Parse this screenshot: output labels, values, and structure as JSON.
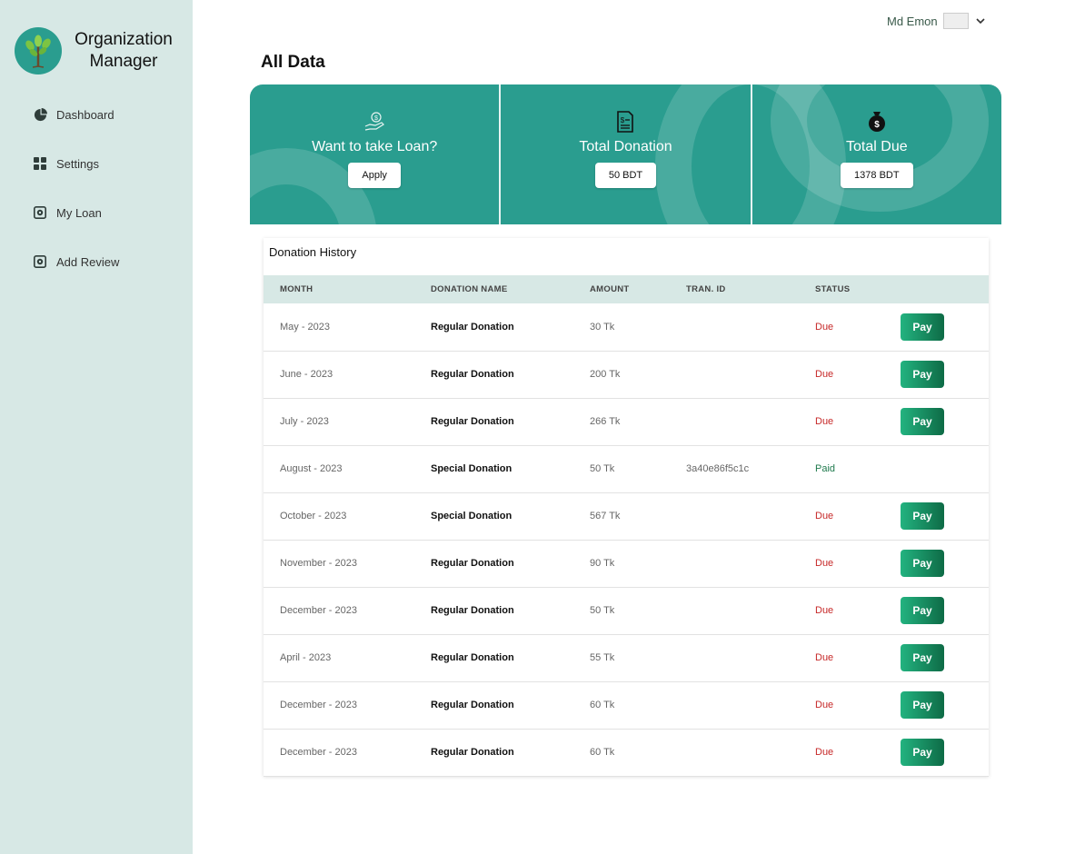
{
  "brand": {
    "name": "Organization Manager"
  },
  "sidebar": {
    "items": [
      {
        "label": "Dashboard",
        "icon": "pie-chart-icon"
      },
      {
        "label": "Settings",
        "icon": "grid-icon"
      },
      {
        "label": "My Loan",
        "icon": "gear-box-icon"
      },
      {
        "label": "Add Review",
        "icon": "gear-box-icon"
      }
    ]
  },
  "header": {
    "user_name": "Md Emon",
    "page_title": "All Data"
  },
  "cards": {
    "loan": {
      "title": "Want to take Loan?",
      "button": "Apply",
      "icon": "money-hand-icon"
    },
    "donation": {
      "title": "Total Donation",
      "value": "50 BDT",
      "icon": "receipt-icon"
    },
    "due": {
      "title": "Total Due",
      "value": "1378 BDT",
      "icon": "money-bag-icon"
    }
  },
  "table": {
    "title": "Donation History",
    "columns": [
      "MONTH",
      "DONATION NAME",
      "AMOUNT",
      "TRAN. ID",
      "STATUS"
    ],
    "pay_label": "Pay",
    "rows": [
      {
        "month": "May - 2023",
        "name": "Regular Donation",
        "amount": "30 Tk",
        "tran_id": "",
        "status": "Due"
      },
      {
        "month": "June - 2023",
        "name": "Regular Donation",
        "amount": "200 Tk",
        "tran_id": "",
        "status": "Due"
      },
      {
        "month": "July - 2023",
        "name": "Regular Donation",
        "amount": "266 Tk",
        "tran_id": "",
        "status": "Due"
      },
      {
        "month": "August - 2023",
        "name": "Special Donation",
        "amount": "50 Tk",
        "tran_id": "3a40e86f5c1c",
        "status": "Paid"
      },
      {
        "month": "October - 2023",
        "name": "Special Donation",
        "amount": "567 Tk",
        "tran_id": "",
        "status": "Due"
      },
      {
        "month": "November - 2023",
        "name": "Regular Donation",
        "amount": "90 Tk",
        "tran_id": "",
        "status": "Due"
      },
      {
        "month": "December - 2023",
        "name": "Regular Donation",
        "amount": "50 Tk",
        "tran_id": "",
        "status": "Due"
      },
      {
        "month": "April - 2023",
        "name": "Regular Donation",
        "amount": "55 Tk",
        "tran_id": "",
        "status": "Due"
      },
      {
        "month": "December - 2023",
        "name": "Regular Donation",
        "amount": "60 Tk",
        "tran_id": "",
        "status": "Due"
      },
      {
        "month": "December - 2023",
        "name": "Regular Donation",
        "amount": "60 Tk",
        "tran_id": "",
        "status": "Due"
      }
    ]
  },
  "colors": {
    "primary": "#2a9d8f",
    "sidebar_bg": "#d7e8e5",
    "due": "#c62828",
    "paid": "#1f7a4d"
  }
}
